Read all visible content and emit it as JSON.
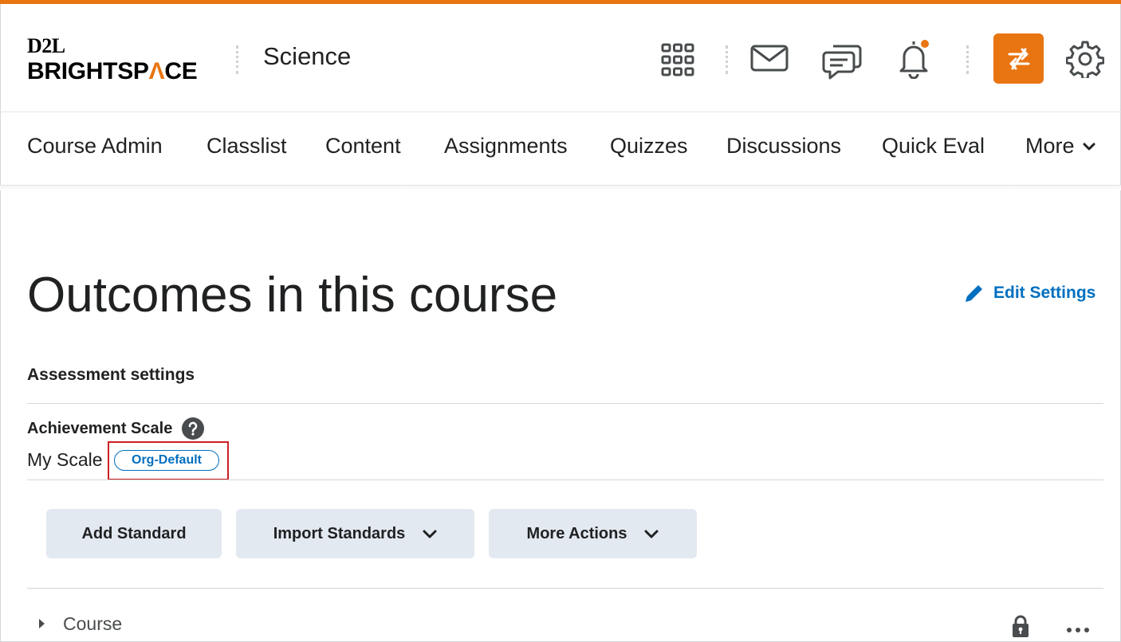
{
  "header": {
    "logo_top": "D2L",
    "logo_bottom_prefix": "BRIGHTSP",
    "logo_bottom_accent": "Λ",
    "logo_bottom_suffix": "CE",
    "course_name": "Science"
  },
  "nav": {
    "items": [
      "Course Admin",
      "Classlist",
      "Content",
      "Assignments",
      "Quizzes",
      "Discussions",
      "Quick Eval"
    ],
    "more_label": "More"
  },
  "main": {
    "title": "Outcomes in this course",
    "edit_settings_label": "Edit Settings",
    "assessment_section": "Assessment settings",
    "achievement_scale_label": "Achievement Scale",
    "scale_value": "My Scale",
    "scale_badge": "Org-Default"
  },
  "buttons": {
    "add_standard": "Add Standard",
    "import_standards": "Import Standards",
    "more_actions": "More Actions"
  },
  "tree": {
    "root_label": "Course"
  },
  "colors": {
    "accent": "#e87511",
    "link": "#006fbf",
    "highlight_box": "#cd2026",
    "button_bg": "#e3e9f1"
  }
}
